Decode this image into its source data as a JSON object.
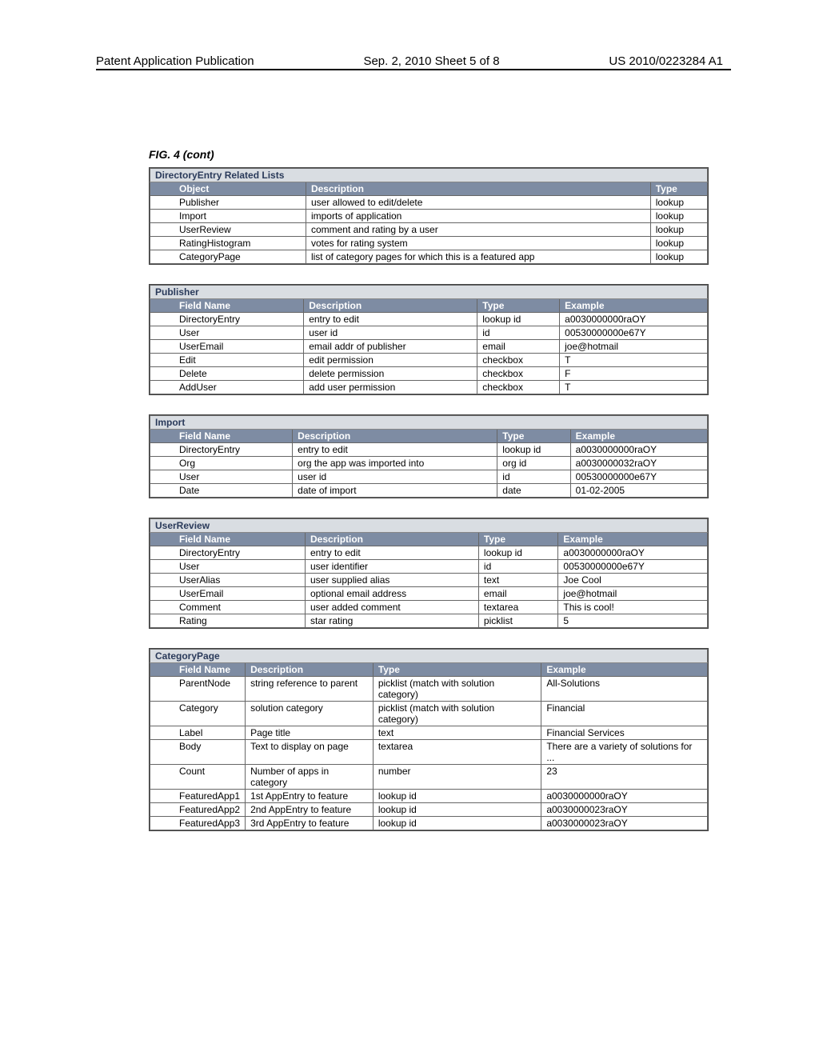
{
  "header": {
    "left": "Patent Application Publication",
    "center": "Sep. 2, 2010   Sheet 5 of 8",
    "right": "US 2010/0223284 A1"
  },
  "figure_label": "FIG. 4 (cont)",
  "tables": {
    "t1": {
      "section": "DirectoryEntry Related Lists",
      "cols": [
        "Object",
        "Description",
        "Type"
      ],
      "rows": [
        [
          "Publisher",
          "user allowed to edit/delete",
          "lookup"
        ],
        [
          "Import",
          "imports of application",
          "lookup"
        ],
        [
          "UserReview",
          "comment and rating by a user",
          "lookup"
        ],
        [
          "RatingHistogram",
          "votes for rating system",
          "lookup"
        ],
        [
          "CategoryPage",
          "list of category pages for which this is a featured app",
          "lookup"
        ]
      ]
    },
    "t2": {
      "section": "Publisher",
      "cols": [
        "Field Name",
        "Description",
        "Type",
        "Example"
      ],
      "rows": [
        [
          "DirectoryEntry",
          "entry to edit",
          "lookup id",
          "a0030000000raOY"
        ],
        [
          "User",
          "user id",
          "id",
          "00530000000e67Y"
        ],
        [
          "UserEmail",
          "email addr of publisher",
          "email",
          "joe@hotmail"
        ],
        [
          "Edit",
          "edit permission",
          "checkbox",
          "T"
        ],
        [
          "Delete",
          "delete permission",
          "checkbox",
          "F"
        ],
        [
          "AddUser",
          "add user permission",
          "checkbox",
          "T"
        ]
      ]
    },
    "t3": {
      "section": "Import",
      "cols": [
        "Field Name",
        "Description",
        "Type",
        "Example"
      ],
      "rows": [
        [
          "DirectoryEntry",
          "entry to edit",
          "lookup id",
          "a0030000000raOY"
        ],
        [
          "Org",
          "org the app was imported into",
          "org id",
          "a0030000032raOY"
        ],
        [
          "User",
          "user id",
          "id",
          "00530000000e67Y"
        ],
        [
          "Date",
          "date of import",
          "date",
          "01-02-2005"
        ]
      ]
    },
    "t4": {
      "section": "UserReview",
      "cols": [
        "Field Name",
        "Description",
        "Type",
        "Example"
      ],
      "rows": [
        [
          "DirectoryEntry",
          "entry to edit",
          "lookup id",
          "a0030000000raOY"
        ],
        [
          "User",
          "user identifier",
          "id",
          "00530000000e67Y"
        ],
        [
          "UserAlias",
          "user supplied alias",
          "text",
          "Joe Cool"
        ],
        [
          "UserEmail",
          "optional email address",
          "email",
          "joe@hotmail"
        ],
        [
          "Comment",
          "user added comment",
          "textarea",
          "This is cool!"
        ],
        [
          "Rating",
          "star rating",
          "picklist",
          "5"
        ]
      ]
    },
    "t5": {
      "section": "CategoryPage",
      "cols": [
        "Field Name",
        "Description",
        "Type",
        "Example"
      ],
      "rows": [
        [
          "ParentNode",
          "string reference to parent",
          "picklist (match with solution category)",
          "All-Solutions"
        ],
        [
          "Category",
          "solution category",
          "picklist (match with solution category)",
          "Financial"
        ],
        [
          "Label",
          "Page title",
          "text",
          "Financial Services"
        ],
        [
          "Body",
          "Text to display on page",
          "textarea",
          "There are a variety of solutions for ..."
        ],
        [
          "Count",
          "Number of apps in category",
          "number",
          "23"
        ],
        [
          "FeaturedApp1",
          "1st AppEntry to feature",
          "lookup id",
          "a0030000000raOY"
        ],
        [
          "FeaturedApp2",
          "2nd AppEntry to feature",
          "lookup id",
          "a0030000023raOY"
        ],
        [
          "FeaturedApp3",
          "3rd AppEntry to feature",
          "lookup id",
          "a0030000023raOY"
        ]
      ]
    }
  }
}
